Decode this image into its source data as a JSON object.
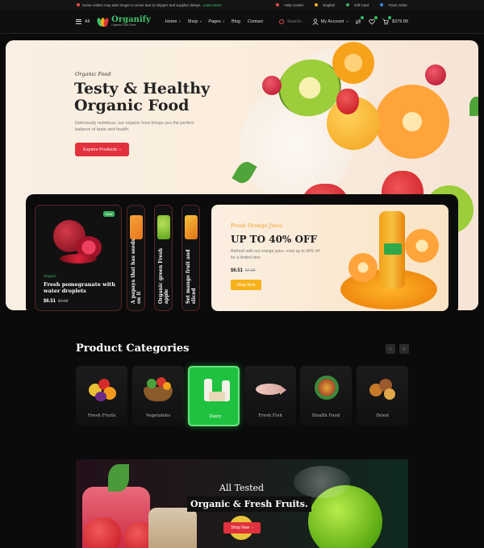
{
  "topbar": {
    "notice": "Some orders may take longer to arrive due to shipper and supplier delays.",
    "notice_link": "Learn More",
    "help": "Help Center",
    "language": "English",
    "gift": "Gift Card",
    "track": "Track Order"
  },
  "header": {
    "all_label": "All",
    "brand": "Organify",
    "brand_tagline": "Organic Food Store",
    "nav": [
      "Home",
      "Shop",
      "Pages",
      "Blog",
      "Contact"
    ],
    "search_placeholder": "Search...",
    "account": "My Account",
    "cart_total": "$379.89"
  },
  "hero": {
    "script": "Organic Food",
    "title_line1": "Testy & Healthy",
    "title_line2": "Organic Food",
    "description": "Deliciously nutritious, our organic food brings you the perfect balance of taste and health.",
    "cta": "Explore Products"
  },
  "featured": {
    "badge": "New",
    "category": "Organic",
    "name": "Fresh pomegranate with water droplets",
    "price": "$6.51",
    "old_price": "$7.99"
  },
  "vertical_cards": [
    "A papaya that has seeds on it",
    "Organic green Fresh apple",
    "Set mango fruit and sliced"
  ],
  "promo": {
    "subtitle": "Fresh Orange Juice",
    "headline": "UP TO 40% OFF",
    "description": "Refresh with our orange juice—now up to 40% off for a limited time.",
    "price": "$6.51",
    "old_price": "$7.99",
    "cta": "Shop Now"
  },
  "categories": {
    "title": "Product Categories",
    "items": [
      "Fresh Fruits",
      "Vegetables",
      "Dairy",
      "Fresh Fish",
      "Health Food",
      "Dried"
    ],
    "active": "Dairy"
  },
  "banner": {
    "line1": "All Tested",
    "line2": "Organic & Fresh Fruits.",
    "cta": "Shop Now"
  }
}
